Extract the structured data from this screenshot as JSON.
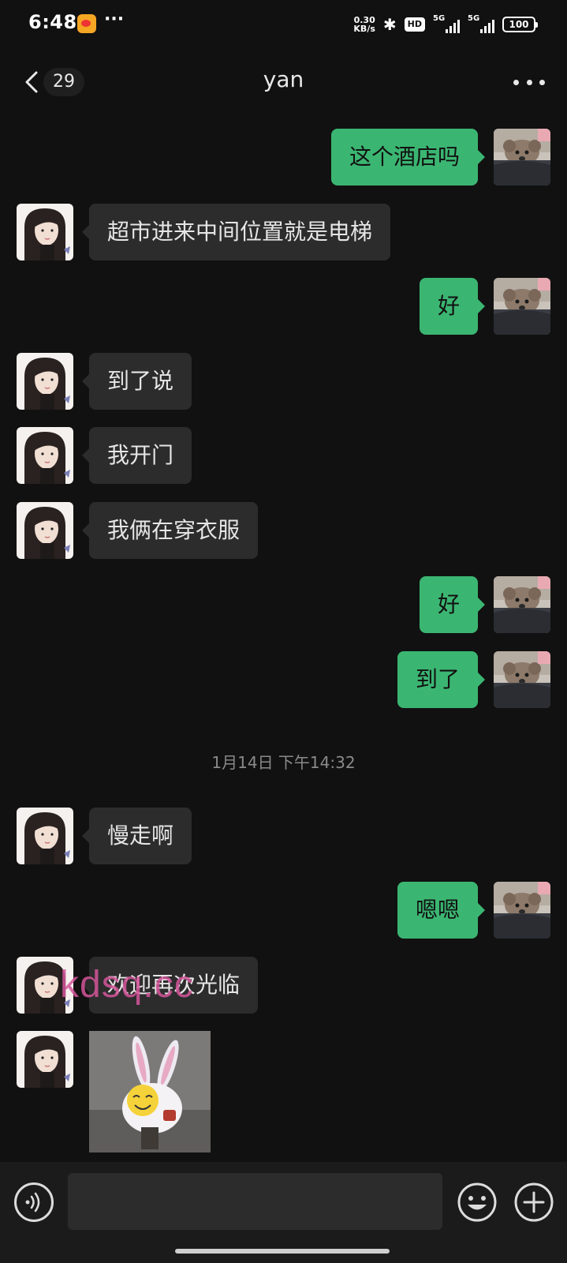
{
  "status_bar": {
    "time": "6:48",
    "speed_value": "0.30",
    "speed_unit": "KB/s",
    "hd_label": "HD",
    "sim1_label": "5G",
    "sim2_label": "5G",
    "battery": "100",
    "icons": [
      "weibo-icon",
      "more-dots",
      "bluetooth-icon",
      "signal-icon",
      "battery-icon"
    ]
  },
  "header": {
    "unread_count": "29",
    "title": "yan",
    "icons": [
      "back-chevron-icon",
      "more-icon"
    ]
  },
  "messages": [
    {
      "side": "right",
      "text": "这个酒店吗"
    },
    {
      "side": "left",
      "text": "超市进来中间位置就是电梯"
    },
    {
      "side": "right",
      "text": "好"
    },
    {
      "side": "left",
      "text": "到了说"
    },
    {
      "side": "left",
      "text": "我开门"
    },
    {
      "side": "left",
      "text": "我俩在穿衣服"
    },
    {
      "side": "right",
      "text": "好"
    },
    {
      "side": "right",
      "text": "到了"
    },
    {
      "side": "left",
      "text": "慢走啊"
    },
    {
      "side": "right",
      "text": "嗯嗯"
    },
    {
      "side": "left",
      "text": "欢迎再次光临"
    },
    {
      "side": "left",
      "type": "sticker",
      "description": "bunny-sticker"
    }
  ],
  "timestamp": "1月14日 下午14:32",
  "watermark": "kdsq.cc",
  "input_bar": {
    "placeholder": "",
    "icons": [
      "voice-icon",
      "emoji-icon",
      "plus-icon"
    ]
  },
  "colors": {
    "background": "#111111",
    "bubble_self": "#3bb672",
    "bubble_other": "#2c2c2c",
    "watermark": "#d4569b"
  }
}
